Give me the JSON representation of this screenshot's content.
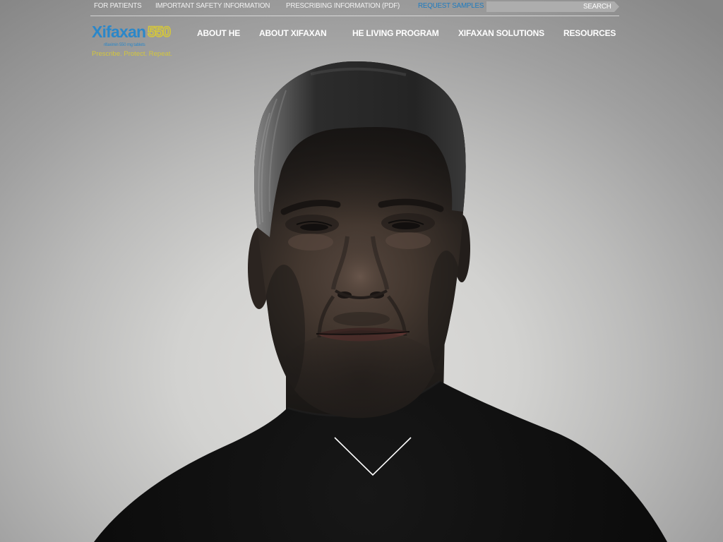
{
  "utility_nav": {
    "items": [
      {
        "label": "FOR PATIENTS"
      },
      {
        "label": "IMPORTANT SAFETY INFORMATION"
      },
      {
        "label": "PRESCRIBING INFORMATION (PDF)"
      },
      {
        "label": "REQUEST SAMPLES"
      }
    ],
    "search": {
      "placeholder": "",
      "button_label": "SEARCH"
    }
  },
  "logo": {
    "brand": "Xifaxan",
    "strength": "550",
    "subtitle": "rifaximin 550 mg tablets",
    "tagline": "Prescribe. Protect. Repeat."
  },
  "main_nav": {
    "items": [
      {
        "label": "ABOUT HE"
      },
      {
        "label": "ABOUT XIFAXAN"
      },
      {
        "label": "HE LIVING PROGRAM"
      },
      {
        "label": "XIFAXAN SOLUTIONS"
      },
      {
        "label": "RESOURCES"
      }
    ]
  },
  "hero": {
    "scroll_icon": "chevron-down-icon"
  },
  "colors": {
    "brand_blue": "#2b87c9",
    "accent_blue": "#1f7cc0",
    "tagline_yellow": "#d4c63c",
    "nav_text": "#ffffff"
  }
}
